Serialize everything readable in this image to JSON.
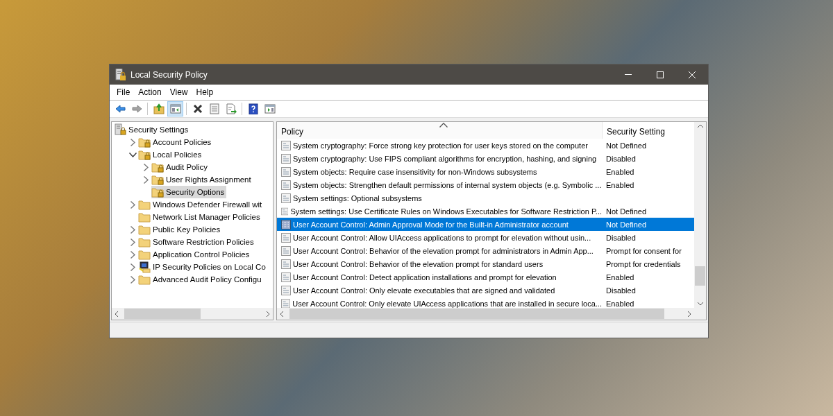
{
  "window": {
    "title": "Local Security Policy"
  },
  "menu": [
    {
      "label": "File"
    },
    {
      "label": "Action"
    },
    {
      "label": "View"
    },
    {
      "label": "Help"
    }
  ],
  "toolbar": [
    {
      "kind": "back",
      "disabled": false
    },
    {
      "kind": "forward",
      "disabled": true
    },
    {
      "kind": "separator"
    },
    {
      "kind": "up",
      "disabled": false
    },
    {
      "kind": "tree",
      "disabled": false,
      "selected": true
    },
    {
      "kind": "separator"
    },
    {
      "kind": "delete",
      "disabled": false
    },
    {
      "kind": "properties",
      "disabled": false
    },
    {
      "kind": "export",
      "disabled": false
    },
    {
      "kind": "separator"
    },
    {
      "kind": "help",
      "disabled": false
    },
    {
      "kind": "actionpane",
      "disabled": false
    }
  ],
  "tree": [
    {
      "label": "Security Settings",
      "kind": "root",
      "selected": false,
      "children": [
        {
          "label": "Account Policies",
          "kind": "lockfolder",
          "expanded": false,
          "selected": false
        },
        {
          "label": "Local Policies",
          "kind": "lockfolder",
          "expanded": true,
          "selected": false,
          "children": [
            {
              "label": "Audit Policy",
              "kind": "lockfolder",
              "expanded": false,
              "selected": false
            },
            {
              "label": "User Rights Assignment",
              "kind": "lockfolder",
              "expanded": false,
              "selected": false
            },
            {
              "label": "Security Options",
              "kind": "lockfolder",
              "selected": true
            }
          ]
        },
        {
          "label": "Windows Defender Firewall wit",
          "kind": "folder",
          "expanded": false,
          "selected": false
        },
        {
          "label": "Network List Manager Policies",
          "kind": "folder",
          "selected": false
        },
        {
          "label": "Public Key Policies",
          "kind": "folder",
          "expanded": false,
          "selected": false
        },
        {
          "label": "Software Restriction Policies",
          "kind": "folder",
          "expanded": false,
          "selected": false
        },
        {
          "label": "Application Control Policies",
          "kind": "folder",
          "expanded": false,
          "selected": false
        },
        {
          "label": "IP Security Policies on Local Co",
          "kind": "network",
          "expanded": false,
          "selected": false
        },
        {
          "label": "Advanced Audit Policy Configu",
          "kind": "folder",
          "expanded": false,
          "selected": false
        }
      ]
    }
  ],
  "table": {
    "columns": [
      {
        "label": "Policy",
        "sorted": true
      },
      {
        "label": "Security Setting",
        "sorted": false
      }
    ],
    "rows": [
      {
        "policy": "System cryptography: Force strong key protection for user keys stored on the computer",
        "setting": "Not Defined",
        "selected": false
      },
      {
        "policy": "System cryptography: Use FIPS compliant algorithms for encryption, hashing, and signing",
        "setting": "Disabled",
        "selected": false
      },
      {
        "policy": "System objects: Require case insensitivity for non-Windows subsystems",
        "setting": "Enabled",
        "selected": false
      },
      {
        "policy": "System objects: Strengthen default permissions of internal system objects (e.g. Symbolic ...",
        "setting": "Enabled",
        "selected": false
      },
      {
        "policy": "System settings: Optional subsystems",
        "selected": false
      },
      {
        "policy": "System settings: Use Certificate Rules on Windows Executables for Software Restriction P...",
        "setting": "Not Defined",
        "selected": false
      },
      {
        "policy": "User Account Control: Admin Approval Mode for the Built-in Administrator account",
        "setting": "Not Defined",
        "selected": true
      },
      {
        "policy": "User Account Control: Allow UIAccess applications to prompt for elevation without usin...",
        "setting": "Disabled",
        "selected": false
      },
      {
        "policy": "User Account Control: Behavior of the elevation prompt for administrators in Admin App...",
        "setting": "Prompt for consent for",
        "selected": false
      },
      {
        "policy": "User Account Control: Behavior of the elevation prompt for standard users",
        "setting": "Prompt for credentials",
        "selected": false
      },
      {
        "policy": "User Account Control: Detect application installations and prompt for elevation",
        "setting": "Enabled",
        "selected": false
      },
      {
        "policy": "User Account Control: Only elevate executables that are signed and validated",
        "setting": "Disabled",
        "selected": false
      },
      {
        "policy": "User Account Control: Only elevate UIAccess applications that are installed in secure loca...",
        "setting": "Enabled",
        "selected": false
      }
    ]
  }
}
